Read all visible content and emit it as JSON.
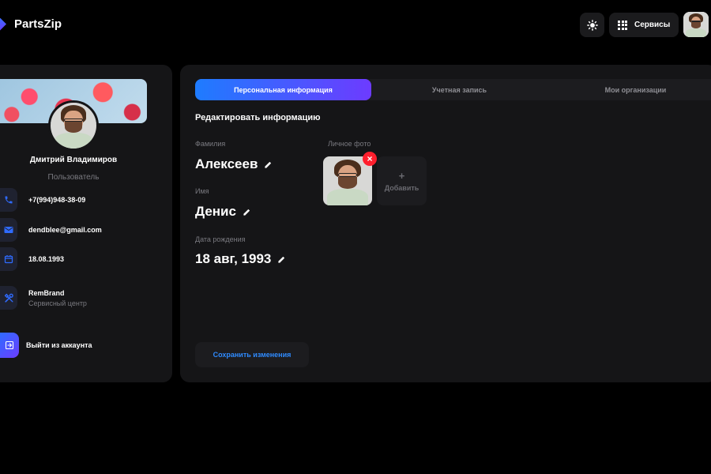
{
  "header": {
    "app_name": "PartsZip",
    "services_label": "Сервисы",
    "theme_icon": "sun-icon",
    "services_icon": "grid-icon"
  },
  "profile": {
    "name": "Дмитрий Владимиров",
    "role": "Пользователь",
    "phone": "+7(994)948-38-09",
    "email": "dendblee@gmail.com",
    "birthdate": "18.08.1993",
    "company_name": "RemBrand",
    "company_type": "Сервисный центр",
    "logout_label": "Выйти из аккаунта"
  },
  "tabs": [
    {
      "label": "Персональная информация",
      "active": true
    },
    {
      "label": "Учетная запись",
      "active": false
    },
    {
      "label": "Мои организации",
      "active": false
    }
  ],
  "form": {
    "title": "Редактировать информацию",
    "last_name_label": "Фамилия",
    "last_name": "Алексеев",
    "first_name_label": "Имя",
    "first_name": "Денис",
    "birth_label": "Дата рождения",
    "birth_value": "18 авг, 1993",
    "photo_label": "Личное фото",
    "add_photo_label": "Добавить",
    "save_label": "Сохранить изменения"
  },
  "colors": {
    "accent_start": "#1e7cff",
    "accent_end": "#6d3bff",
    "danger": "#ff1f2d",
    "card_bg": "#151517"
  }
}
